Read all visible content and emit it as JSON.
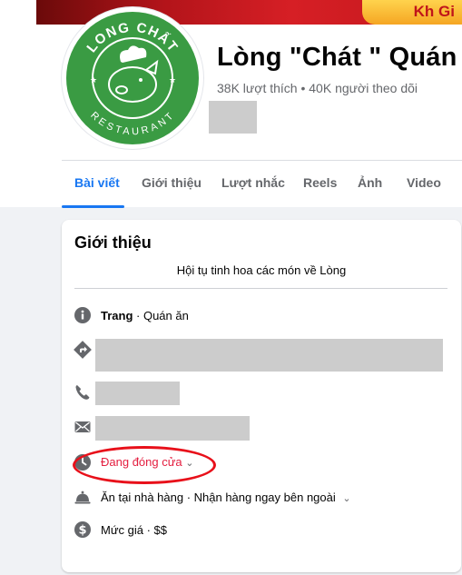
{
  "cover": {
    "banner_text": "Kh Gi",
    "colors": {
      "cover": "#c2171c",
      "ribbon": "#f5a623"
    }
  },
  "logo": {
    "top_text": "LONG CHẤT",
    "bottom_text": "RESTAURANT",
    "color": "#3a9b43"
  },
  "page": {
    "title": "Lòng \"Chát \" Quán",
    "stats": "38K lượt thích • 40K người theo dõi"
  },
  "tabs": [
    {
      "label": "Bài viết",
      "active": true
    },
    {
      "label": "Giới thiệu"
    },
    {
      "label": "Lượt nhắc"
    },
    {
      "label": "Reels"
    },
    {
      "label": "Ảnh"
    },
    {
      "label": "Video"
    }
  ],
  "intro": {
    "title": "Giới thiệu",
    "bio": "Hội tụ tinh hoa các món về Lòng",
    "category_label": "Trang",
    "category_value": " · Quán ăn",
    "hours_status": "Đang đóng cửa",
    "services": "Ăn tại nhà hàng · Nhận hàng ngay bên ngoài",
    "price": "Mức giá · $$"
  },
  "colors": {
    "accent": "#1877f2",
    "closed": "#e41e3f",
    "annotation": "#e8101a",
    "icon": "#65676b"
  }
}
